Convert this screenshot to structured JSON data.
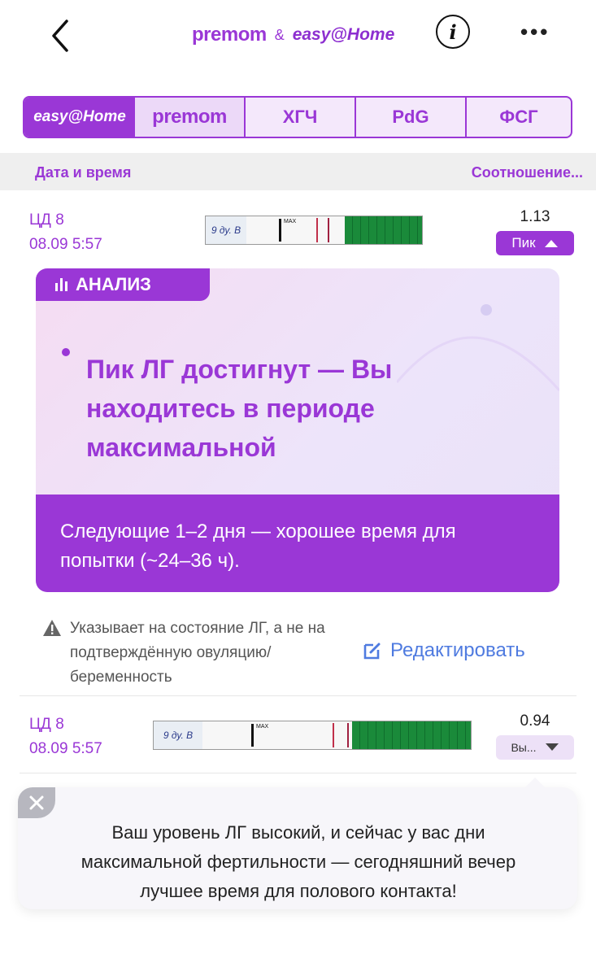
{
  "header": {
    "brand_left": "premom",
    "brand_amp": "&",
    "brand_right": "easy@Home"
  },
  "tabs": [
    "easy@Home",
    "premom",
    "ХГЧ",
    "PdG",
    "ФСГ"
  ],
  "table_header": {
    "left": "Дата и время",
    "right": "Соотношение..."
  },
  "entries": [
    {
      "cycle_day": "ЦД 8",
      "datetime": "08.09 5:57",
      "strip_label": "9 ду. В",
      "strip_marks": "MAX",
      "ratio": "1.13",
      "badge": "Пик"
    },
    {
      "cycle_day": "ЦД 8",
      "datetime": "08.09 5:57",
      "strip_label": "9 ду. В",
      "strip_marks": "MAX",
      "ratio": "0.94",
      "badge": "Вы..."
    }
  ],
  "analysis": {
    "tag": "АНАЛИЗ",
    "headline": "Пик ЛГ достигнут — Вы находитесь в периоде максимальной",
    "advice": "Следующие 1–2 дня — хорошее время для попытки (~24–36 ч)."
  },
  "warning": "Указывает на состояние ЛГ, а не на подтверждённую овуляцию/беременность",
  "edit_label": "Редактировать",
  "tooltip": "Ваш уровень ЛГ высокий, и сейчас у вас дни максимальной фертильности — сегодняшний вечер лучшее время для полового контакта!",
  "colors": {
    "accent": "#9a37d6",
    "link": "#4f7be0"
  }
}
